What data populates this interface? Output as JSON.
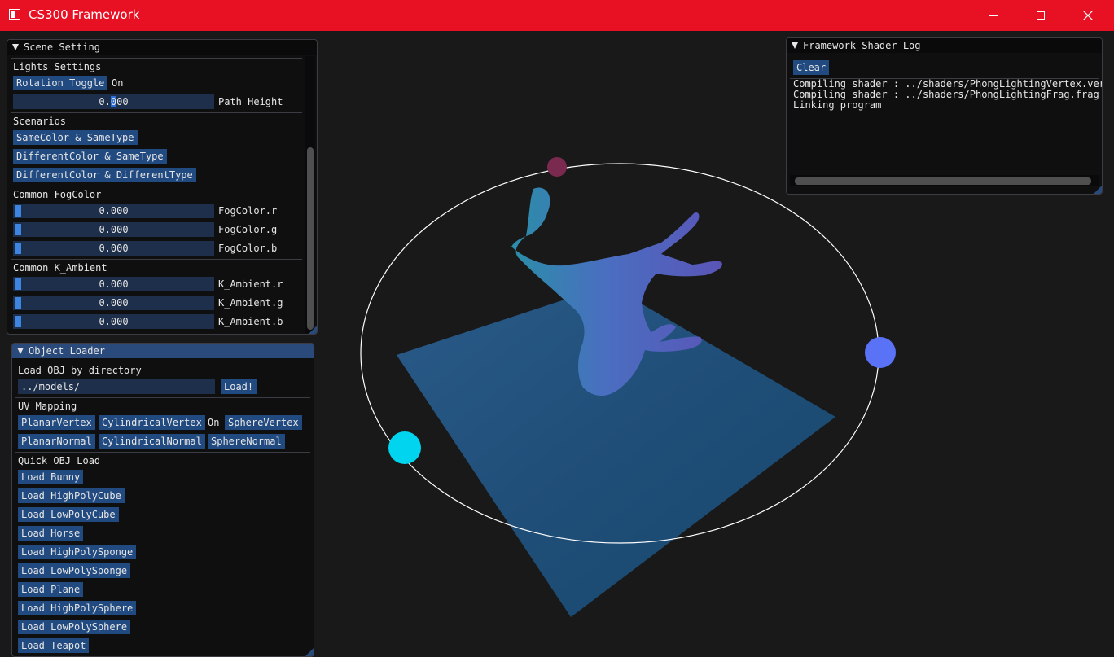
{
  "window": {
    "title": "CS300 Framework"
  },
  "scene_setting": {
    "title": "Scene Setting",
    "lights_header": "Lights Settings",
    "rotation_toggle_label": "Rotation Toggle",
    "rotation_state": "On",
    "path_height_value_a": "0.",
    "path_height_value_sel": "0",
    "path_height_value_b": "00",
    "path_height_label": "Path Height",
    "scenarios_header": "Scenarios",
    "scenarios": [
      "SameColor & SameType",
      "DifferentColor & SameType",
      "DifferentColor & DifferentType"
    ],
    "fog_header": "Common FogColor",
    "fog": [
      {
        "value": "0.000",
        "label": "FogColor.r"
      },
      {
        "value": "0.000",
        "label": "FogColor.g"
      },
      {
        "value": "0.000",
        "label": "FogColor.b"
      }
    ],
    "ambient_header": "Common K_Ambient",
    "ambient": [
      {
        "value": "0.000",
        "label": "K_Ambient.r"
      },
      {
        "value": "0.000",
        "label": "K_Ambient.g"
      },
      {
        "value": "0.000",
        "label": "K_Ambient.b"
      }
    ]
  },
  "object_loader": {
    "title": "Object Loader",
    "load_header": "Load OBJ by directory",
    "directory_value": "../models/",
    "load_button": "Load!",
    "uv_header": "UV Mapping",
    "uv_row1": [
      "PlanarVertex",
      "CylindricalVertex",
      "SphereVertex"
    ],
    "uv_state": "On",
    "uv_row2": [
      "PlanarNormal",
      "CylindricalNormal",
      "SphereNormal"
    ],
    "quick_header": "Quick OBJ Load",
    "quick": [
      "Load Bunny",
      "Load HighPolyCube",
      "Load LowPolyCube",
      "Load Horse",
      "Load HighPolySponge",
      "Load LowPolySponge",
      "Load Plane",
      "Load HighPolySphere",
      "Load LowPolySphere",
      "Load Teapot"
    ]
  },
  "shader_log": {
    "title": "Framework Shader Log",
    "clear_button": "Clear",
    "lines": [
      "Compiling shader : ../shaders/PhongLightingVertex.ver",
      "Compiling shader : ../shaders/PhongLightingFrag.frag",
      "Linking program"
    ]
  },
  "colors": {
    "titlebar": "#e81123",
    "button": "#214a80",
    "frame": "#1d2f4a",
    "light_top": "#7a2a4e",
    "light_right": "#5a72f5",
    "light_left": "#00d4ee"
  }
}
